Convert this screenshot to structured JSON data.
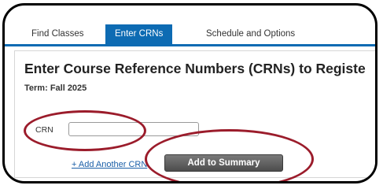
{
  "tabs": [
    {
      "label": "Find Classes",
      "active": false
    },
    {
      "label": "Enter CRNs",
      "active": true
    },
    {
      "label": "Schedule and Options",
      "active": false
    }
  ],
  "main": {
    "heading": "Enter Course Reference Numbers (CRNs) to Registe",
    "term_label": "Term: ",
    "term_value": "Fall 2025",
    "crn_label": "CRN",
    "crn_value": "",
    "add_another_label": "+ Add Another CRN",
    "add_to_summary_label": "Add to Summary"
  },
  "colors": {
    "accent": "#0d6bb3",
    "highlight_marker": "#9b1c2b",
    "button_bg": "#5a5a5a"
  }
}
